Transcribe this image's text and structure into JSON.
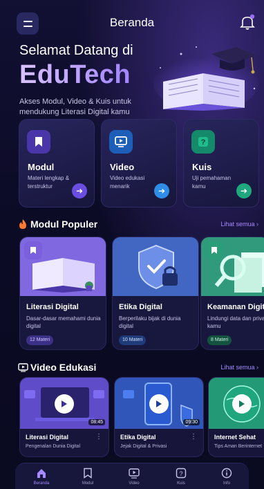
{
  "header": {
    "title": "Beranda"
  },
  "hero": {
    "greeting": "Selamat Datang di",
    "brand": "EduTech",
    "tagline": "Akses Modul, Video & Kuis untuk mendukung Literasi Digital kamu"
  },
  "quick_cards": [
    {
      "label": "Modul",
      "desc": "Materi lengkap & terstruktur",
      "icon": "bookmark-icon",
      "color": "#7a5cf0"
    },
    {
      "label": "Video",
      "desc": "Video edukasi menarik",
      "icon": "monitor-play-icon",
      "color": "#2f8de8"
    },
    {
      "label": "Kuis",
      "desc": "Uji pemahaman kamu",
      "icon": "question-icon",
      "color": "#1fbd8c"
    }
  ],
  "popular": {
    "title": "Modul Populer",
    "see_all": "Lihat semua",
    "items": [
      {
        "title": "Literasi Digital",
        "desc": "Dasar-dasar memahami dunia digital",
        "count": "12 Materi"
      },
      {
        "title": "Etika Digital",
        "desc": "Berperilaku bijak di dunia digital",
        "count": "10 Materi"
      },
      {
        "title": "Keamanan Digital",
        "desc": "Lindungi data dan privasi kamu",
        "count": "8 Materi"
      }
    ]
  },
  "videos": {
    "title": "Video Edukasi",
    "see_all": "Lihat semua",
    "items": [
      {
        "title": "Literasi Digital",
        "desc": "Pengenalan Dunia Digital",
        "duration": "08:45"
      },
      {
        "title": "Etika Digital",
        "desc": "Jejak Digital & Privasi",
        "duration": "09:30"
      },
      {
        "title": "Internet Sehat",
        "desc": "Tips Aman Berinternet",
        "duration": ""
      }
    ]
  },
  "nav": [
    {
      "label": "Beranda",
      "icon": "home-icon",
      "active": true
    },
    {
      "label": "Modul",
      "icon": "bookmark-icon"
    },
    {
      "label": "Video",
      "icon": "monitor-play-icon"
    },
    {
      "label": "Kuis",
      "icon": "question-icon"
    },
    {
      "label": "Info",
      "icon": "info-icon"
    }
  ],
  "colors": {
    "accent": "#a58bff",
    "background": "#0b0a24"
  }
}
